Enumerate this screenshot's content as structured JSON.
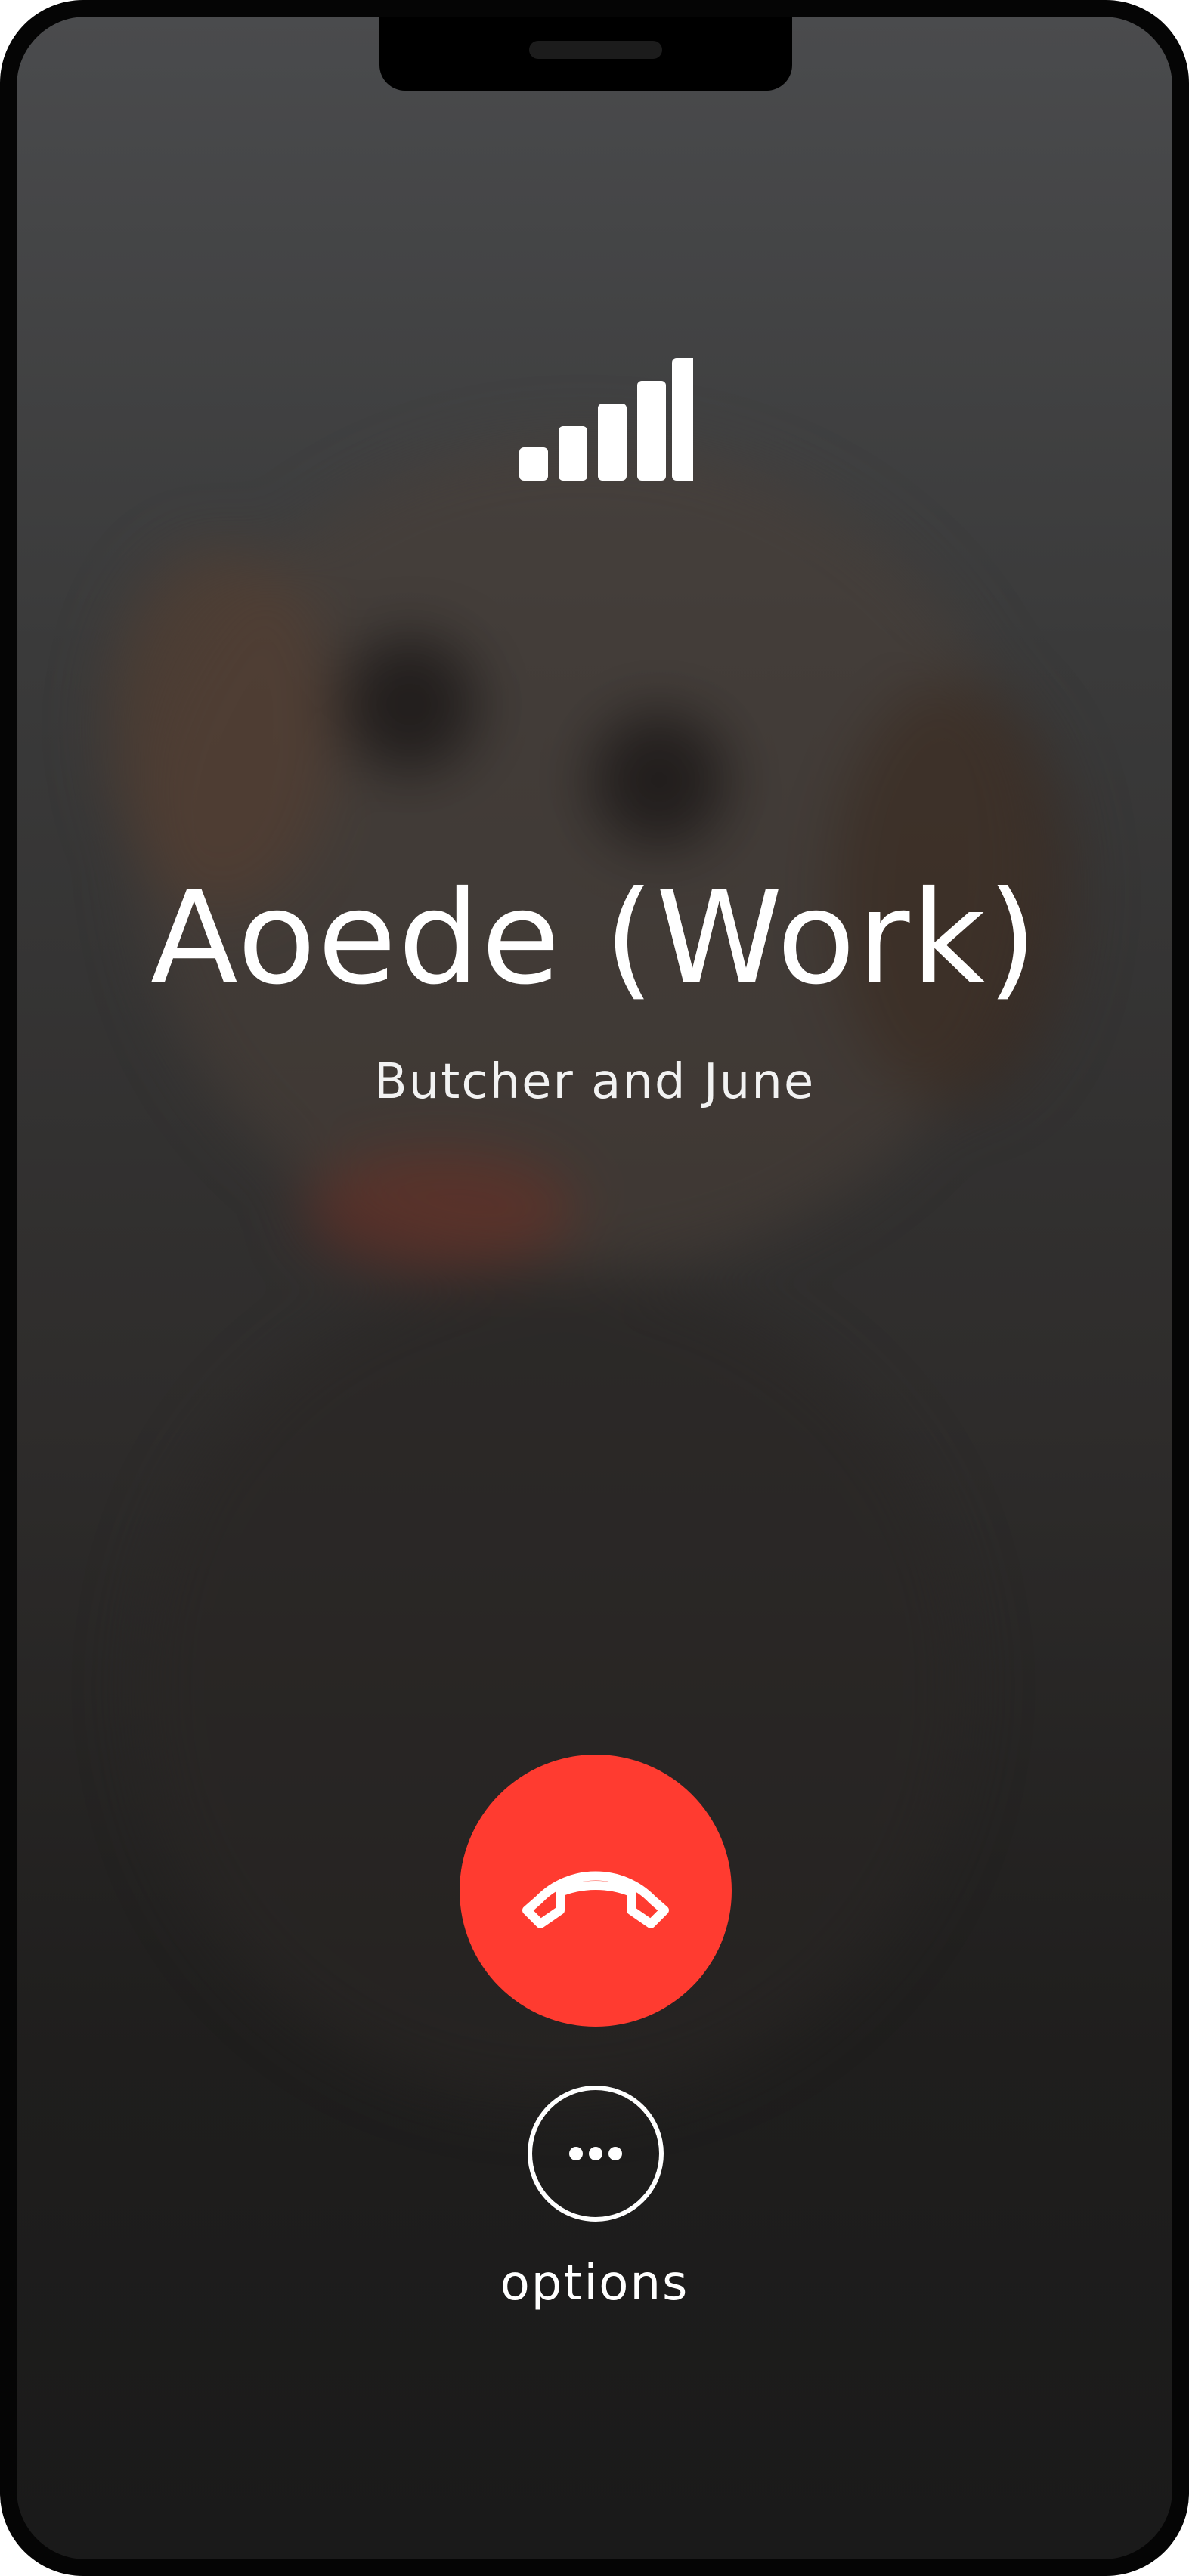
{
  "call": {
    "caller_name": "Aoede (Work)",
    "caller_subtitle": "Butcher and June",
    "options_label": "options"
  },
  "icons": {
    "signal": "signal-strength-icon",
    "hangup": "phone-hangup-icon",
    "options": "ellipsis-icon"
  },
  "colors": {
    "hangup_red": "#ff3b30",
    "text": "#ffffff"
  }
}
